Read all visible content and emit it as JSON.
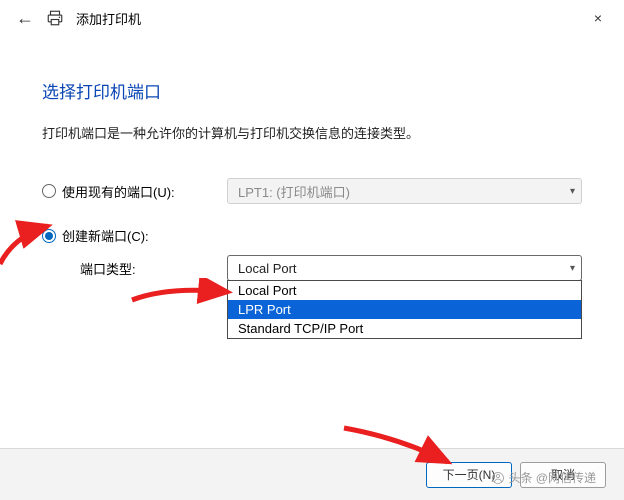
{
  "window": {
    "title": "添加打印机",
    "close": "×",
    "back": "←"
  },
  "heading": "选择打印机端口",
  "description": "打印机端口是一种允许你的计算机与打印机交换信息的连接类型。",
  "optionUseExisting": {
    "label": "使用现有的端口(U):",
    "value": "LPT1: (打印机端口)"
  },
  "optionCreateNew": {
    "label": "创建新端口(C):",
    "portTypeLabel": "端口类型:",
    "selectedValue": "Local Port",
    "options": [
      "Local Port",
      "LPR Port",
      "Standard TCP/IP Port"
    ],
    "highlightedIndex": 1
  },
  "footer": {
    "next": "下一页(N)",
    "cancel": "取消"
  },
  "watermark": "头条 @网信传递"
}
